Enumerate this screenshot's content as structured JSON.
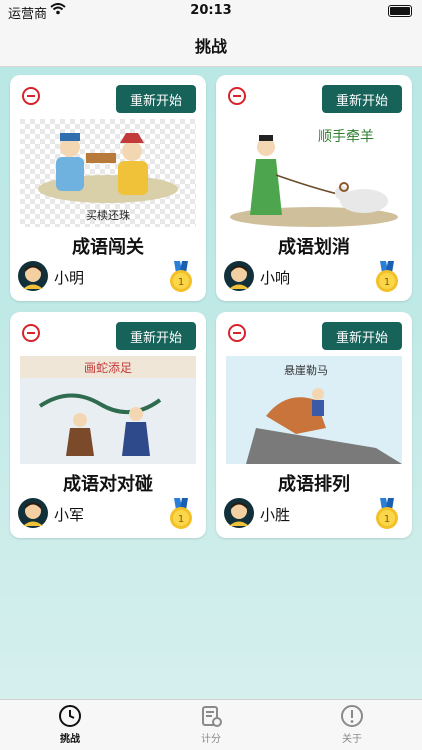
{
  "status": {
    "carrier": "运营商",
    "time": "20:13"
  },
  "nav": {
    "title": "挑战"
  },
  "cards": [
    {
      "restart": "重新开始",
      "title": "成语闯关",
      "player": "小明",
      "medal": "1",
      "art_caption": "买椟还珠"
    },
    {
      "restart": "重新开始",
      "title": "成语划消",
      "player": "小响",
      "medal": "1",
      "art_caption": "顺手牵羊"
    },
    {
      "restart": "重新开始",
      "title": "成语对对碰",
      "player": "小军",
      "medal": "1",
      "art_caption": "画蛇添足"
    },
    {
      "restart": "重新开始",
      "title": "成语排列",
      "player": "小胜",
      "medal": "1",
      "art_caption": "悬崖勒马"
    }
  ],
  "tabs": [
    {
      "label": "挑战",
      "icon": "clock-icon",
      "active": true
    },
    {
      "label": "计分",
      "icon": "scoresheet-icon",
      "active": false
    },
    {
      "label": "关于",
      "icon": "info-icon",
      "active": false
    }
  ],
  "colors": {
    "accent": "#17635a",
    "remove": "#d8232a",
    "background": "#bfe9e6"
  }
}
